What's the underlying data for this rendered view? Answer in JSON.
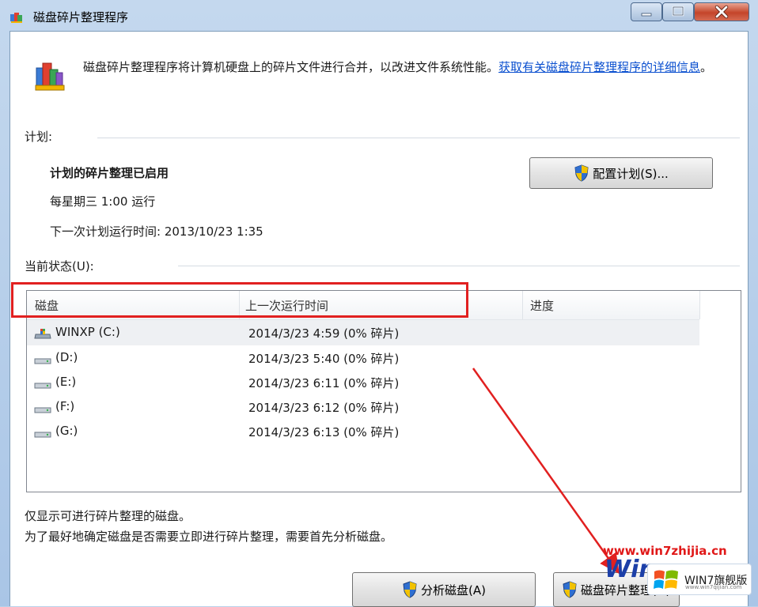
{
  "window": {
    "title": "磁盘碎片整理程序"
  },
  "description": {
    "text": "磁盘碎片整理程序将计算机硬盘上的碎片文件进行合并，以改进文件系统性能。",
    "link": "获取有关磁盘碎片整理程序的详细信息",
    "trail": "。"
  },
  "schedule": {
    "label": "计划:",
    "status": "计划的碎片整理已启用",
    "frequency": "每星期三  1:00 运行",
    "next_run": "下一次计划运行时间: 2013/10/23 1:35",
    "configure_button": "配置计划(S)..."
  },
  "current_status": {
    "label": "当前状态(U):",
    "columns": [
      "磁盘",
      "上一次运行时间",
      "进度"
    ],
    "disks": [
      {
        "name": "WINXP (C:)",
        "last_run": "2014/3/23 4:59 (0% 碎片)",
        "progress": "",
        "icon": "system-drive-icon"
      },
      {
        "name": "(D:)",
        "last_run": "2014/3/23 5:40 (0% 碎片)",
        "progress": "",
        "icon": "drive-icon"
      },
      {
        "name": "(E:)",
        "last_run": "2014/3/23 6:11 (0% 碎片)",
        "progress": "",
        "icon": "drive-icon"
      },
      {
        "name": "(F:)",
        "last_run": "2014/3/23 6:12 (0% 碎片)",
        "progress": "",
        "icon": "drive-icon"
      },
      {
        "name": "(G:)",
        "last_run": "2014/3/23 6:13 (0% 碎片)",
        "progress": "",
        "icon": "drive-icon"
      }
    ]
  },
  "notes": {
    "line1": "仅显示可进行碎片整理的磁盘。",
    "line2": "为了最好地确定磁盘是否需要立即进行碎片整理，需要首先分析磁盘。"
  },
  "buttons": {
    "analyze": "分析磁盘(A)",
    "defragment": "磁盘碎片整理(D)"
  },
  "watermark": {
    "url": "www.win7zhijia.cn",
    "big": "Win",
    "badge_text": "WIN7旗舰版",
    "small": "www.win7qijian.com"
  },
  "colors": {
    "annotation": "#e12020",
    "link": "#0a4fcf"
  }
}
